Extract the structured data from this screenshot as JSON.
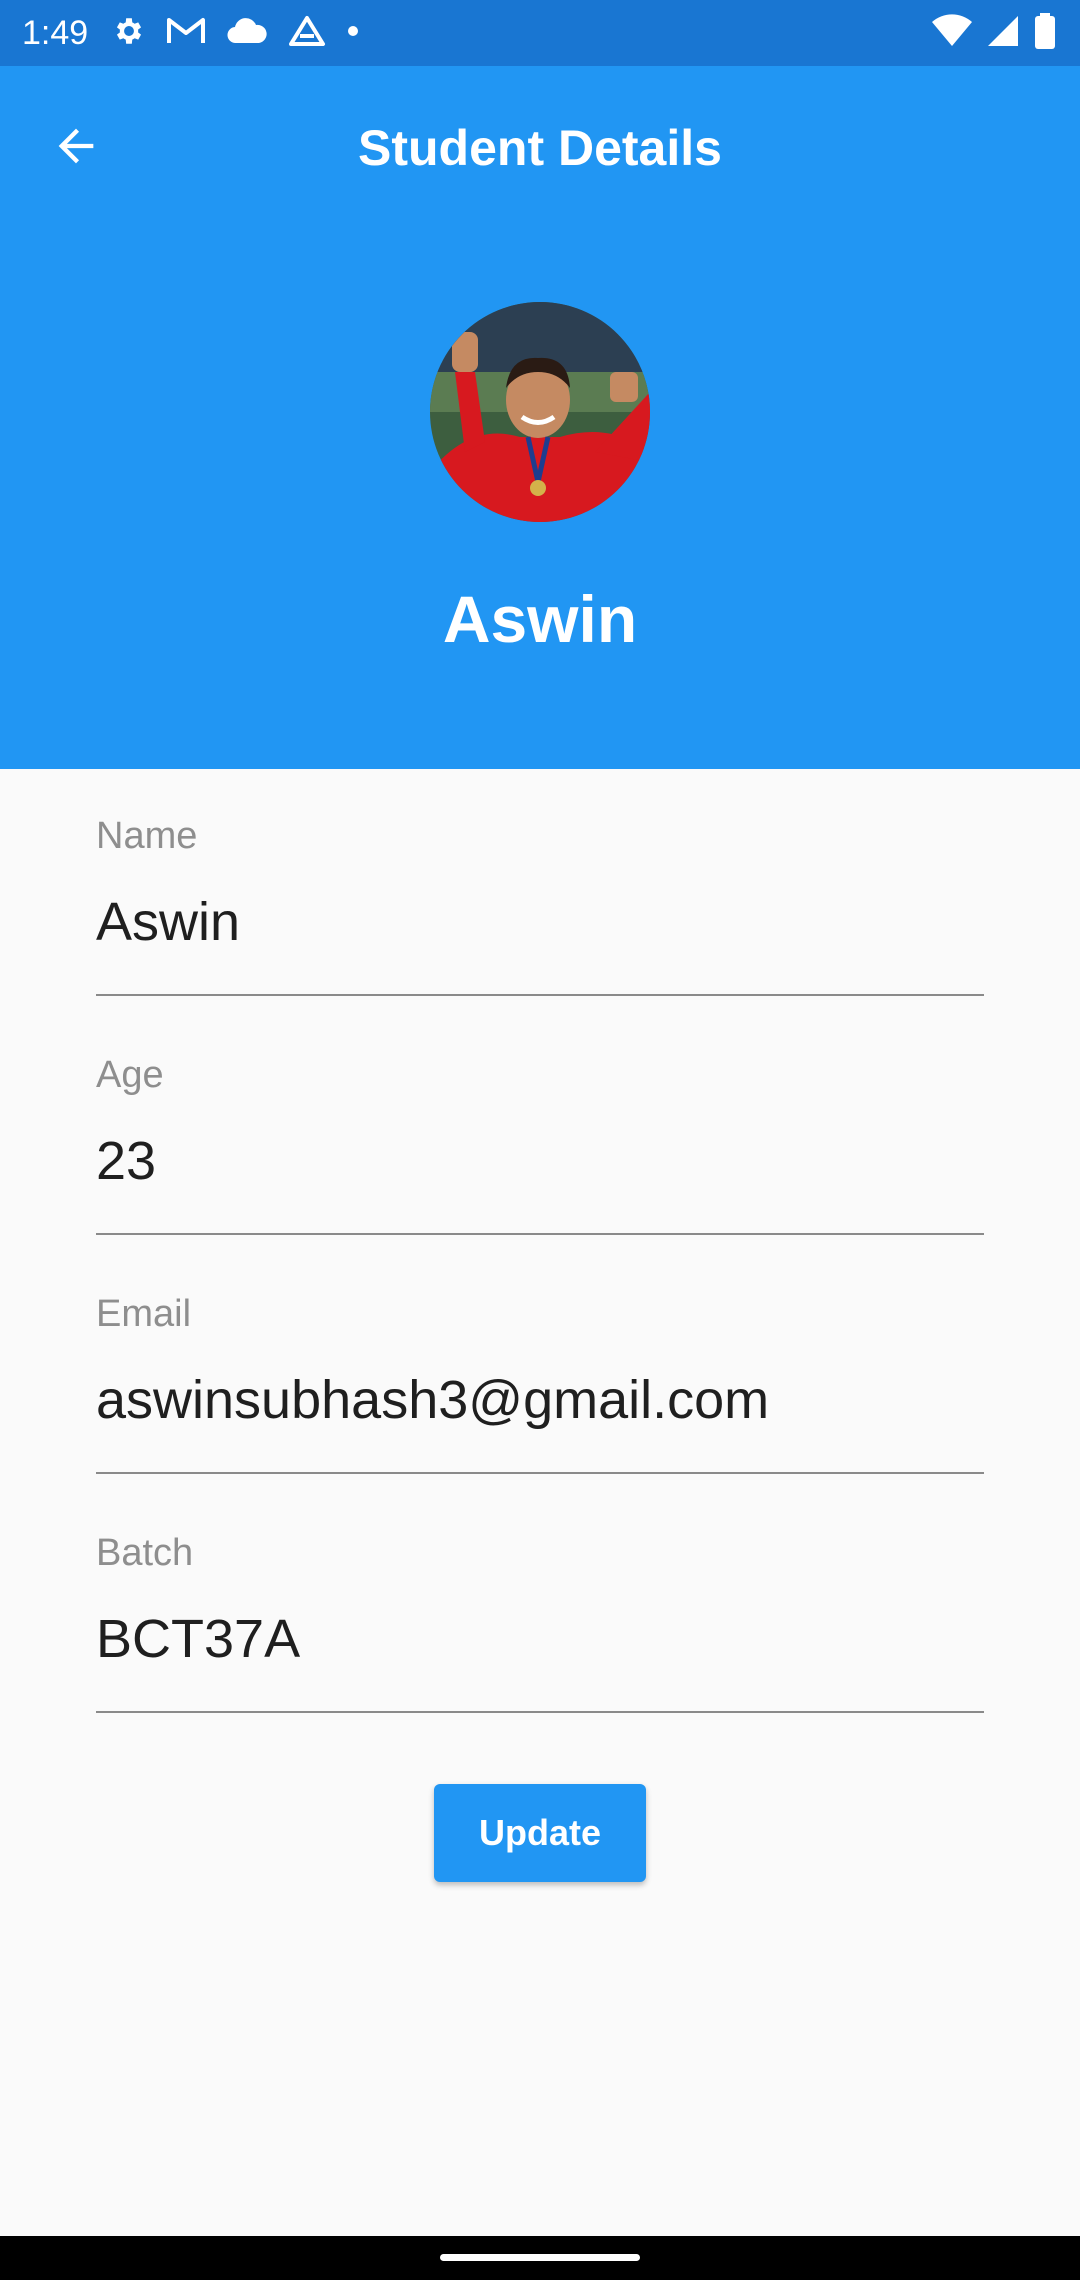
{
  "status_bar": {
    "time": "1:49",
    "left_icons": [
      "settings-icon",
      "gmail-icon",
      "cloud-icon",
      "drive-icon",
      "dot-icon"
    ],
    "right_icons": [
      "wifi-icon",
      "signal-icon",
      "battery-icon"
    ],
    "background": "#1976D2"
  },
  "header": {
    "title": "Student Details",
    "profile_name": "Aswin",
    "background": "#2196F3"
  },
  "form": {
    "name": {
      "label": "Name",
      "value": "Aswin"
    },
    "age": {
      "label": "Age",
      "value": "23"
    },
    "email": {
      "label": "Email",
      "value": "aswinsubhash3@gmail.com"
    },
    "batch": {
      "label": "Batch",
      "value": "BCT37A"
    }
  },
  "actions": {
    "update_label": "Update",
    "accent": "#2196F3"
  }
}
